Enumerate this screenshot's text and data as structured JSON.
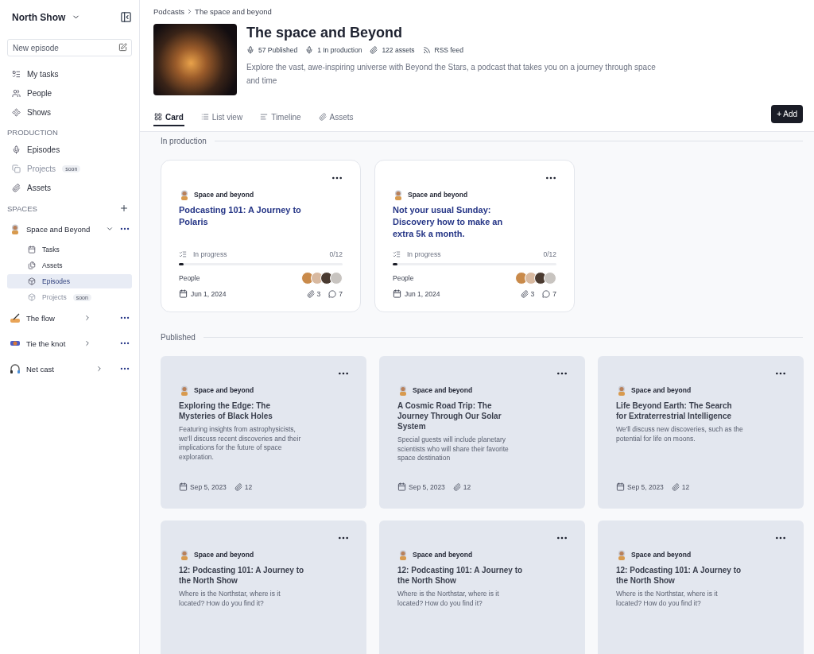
{
  "sidebar": {
    "workspace": "North Show",
    "new_episode": {
      "placeholder": "New episode"
    },
    "nav": [
      {
        "label": "My tasks"
      },
      {
        "label": "People"
      },
      {
        "label": "Shows"
      }
    ],
    "production": {
      "title": "PRODUCTION",
      "items": [
        {
          "label": "Episodes",
          "disabled": false
        },
        {
          "label": "Projects",
          "disabled": true,
          "badge": "soon"
        },
        {
          "label": "Assets",
          "disabled": false
        }
      ]
    },
    "spaces": {
      "title": "SPACES",
      "items": [
        {
          "label": "Space and Beyond",
          "expanded": true,
          "children": [
            {
              "label": "Tasks",
              "selected": false,
              "disabled": false
            },
            {
              "label": "Assets",
              "selected": false,
              "disabled": false
            },
            {
              "label": "Episodes",
              "selected": true,
              "disabled": false
            },
            {
              "label": "Projects",
              "selected": false,
              "disabled": true,
              "badge": "soon"
            }
          ]
        },
        {
          "label": "The flow",
          "expanded": false
        },
        {
          "label": "Tie the knot",
          "expanded": false
        },
        {
          "label": "Net cast",
          "expanded": false
        }
      ]
    }
  },
  "breadcrumb": [
    "Podcasts",
    "The space and beyond"
  ],
  "show": {
    "title": "The space and Beyond",
    "stats": [
      "57 Published",
      "1 In production",
      "122 assets",
      "RSS feed"
    ],
    "description": "Explore the vast, awe-inspiring universe with Beyond the Stars, a podcast that takes you on a journey through space and time"
  },
  "tabs": [
    {
      "label": "Card",
      "selected": true
    },
    {
      "label": "List view",
      "selected": false
    },
    {
      "label": "Timeline",
      "selected": false
    },
    {
      "label": "Assets",
      "selected": false
    }
  ],
  "add_button": "+ Add",
  "in_production": {
    "title": "In production",
    "cards": [
      {
        "space": "Space and beyond",
        "title": "Podcasting 101: A Journey to Polaris",
        "status": "In progress",
        "count": "0/12",
        "level": 0.03,
        "people_label": "People",
        "date": "Jun 1, 2024",
        "attachments": "3",
        "comments": "7"
      },
      {
        "space": "Space and beyond",
        "title": "Not your usual Sunday: Discovery how to make an extra 5k a month.",
        "status": "In progress",
        "count": "0/12",
        "level": 0.03,
        "people_label": "People",
        "date": "Jun 1, 2024",
        "attachments": "3",
        "comments": "7"
      }
    ]
  },
  "published": {
    "title": "Published",
    "cards": [
      {
        "space": "Space and beyond",
        "title": "Exploring the Edge: The Mysteries of Black Holes",
        "description": "Featuring insights from astrophysicists, we'll discuss recent discoveries and their implications for the future of space exploration.",
        "date": "Sep 5, 2023",
        "attachments": "12"
      },
      {
        "space": "Space and beyond",
        "title": "A Cosmic Road Trip: The Journey Through Our Solar System",
        "description": "Special guests will include planetary scientists who will share their favorite space destination",
        "date": "Sep 5, 2023",
        "attachments": "12"
      },
      {
        "space": "Space and beyond",
        "title": "Life Beyond Earth: The Search for Extraterrestrial Intelligence",
        "description": "We'll discuss new discoveries, such as the potential for life on moons.",
        "date": "Sep 5, 2023",
        "attachments": "12"
      },
      {
        "space": "Space and beyond",
        "title": "12: Podcasting 101: A Journey to the North Show",
        "description": "Where is the Northstar, where is it located? How do you find it?"
      },
      {
        "space": "Space and beyond",
        "title": "12: Podcasting 101: A Journey to the North Show",
        "description": "Where is the Northstar, where is it located? How do you find it?"
      },
      {
        "space": "Space and beyond",
        "title": "12: Podcasting 101: A Journey to the North Show",
        "description": "Where is the Northstar, where is it located? How do you find it?"
      }
    ]
  }
}
